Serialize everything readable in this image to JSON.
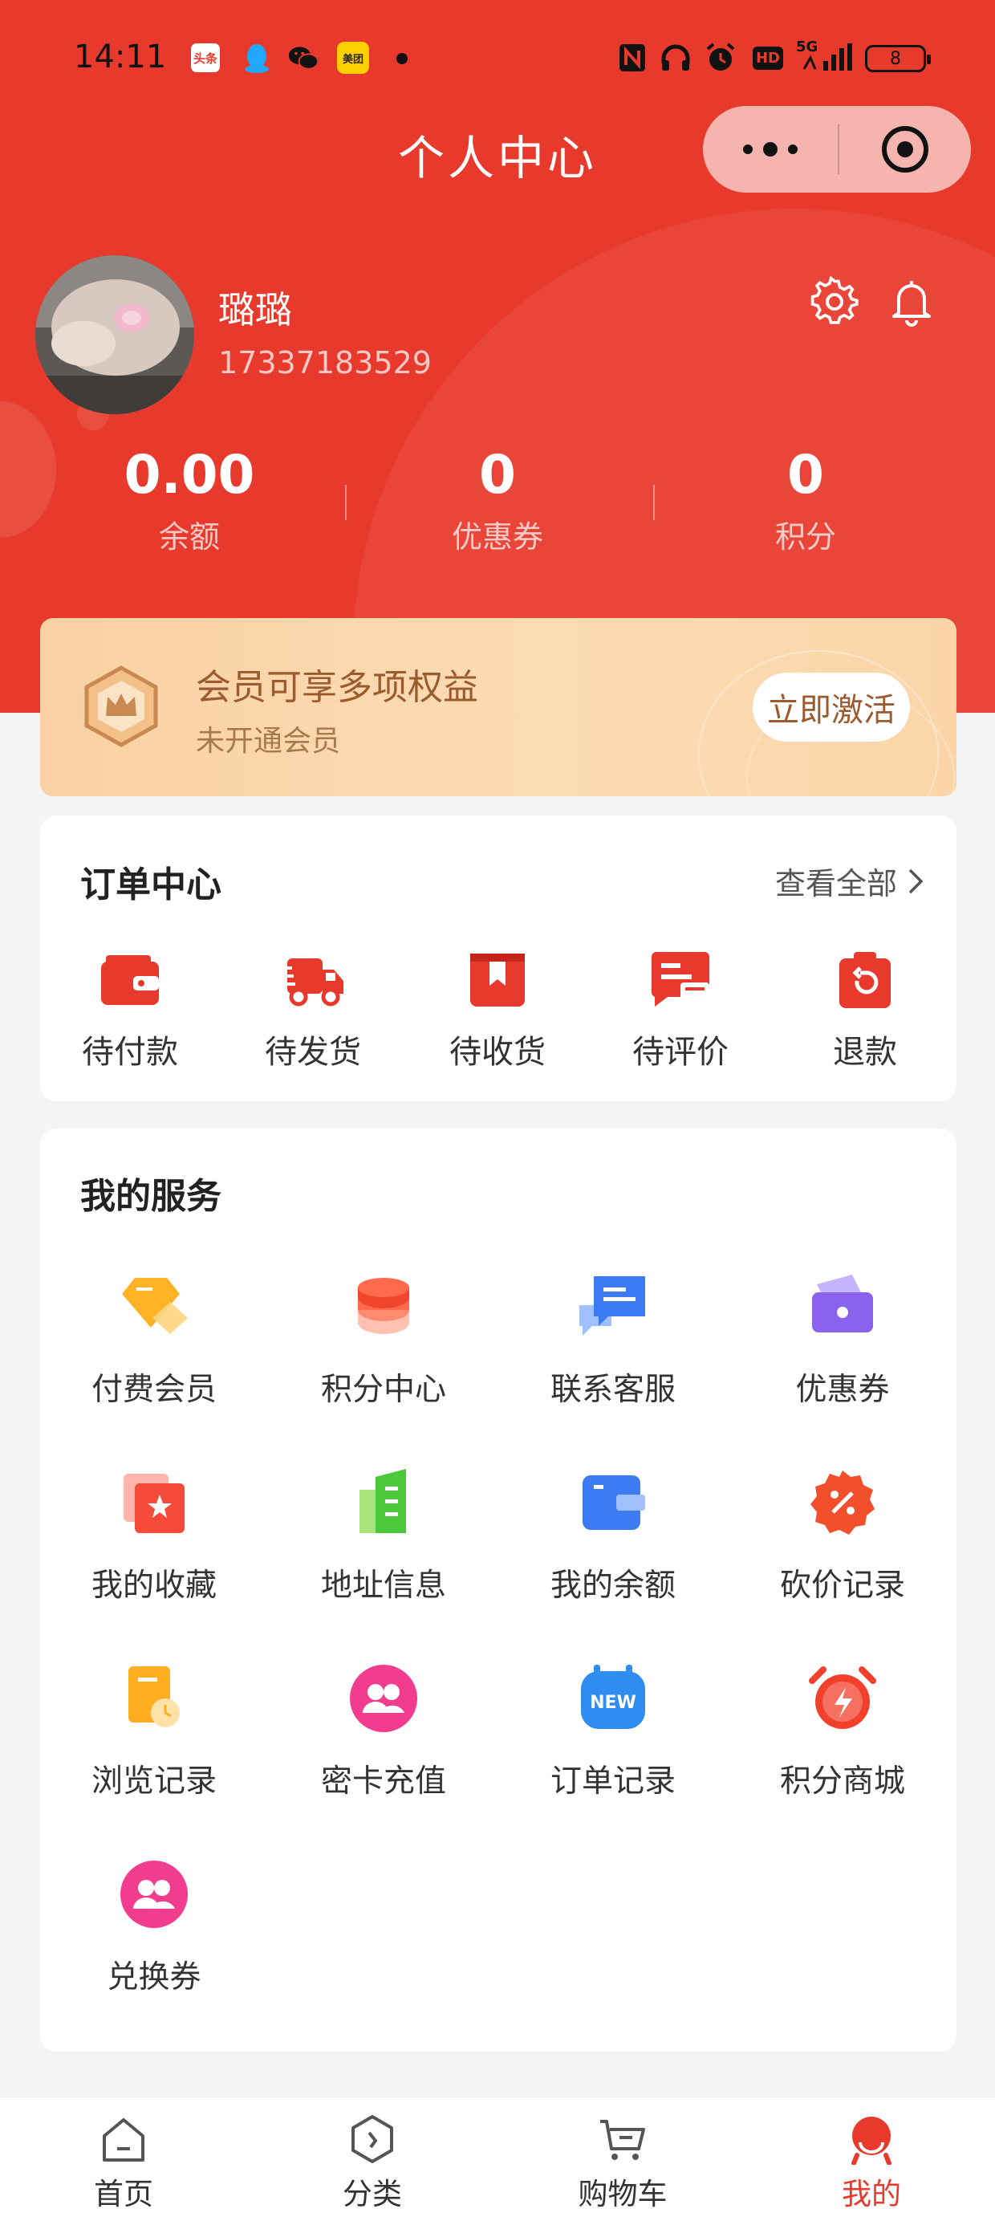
{
  "status_bar": {
    "time": "14:11",
    "battery": "8",
    "app_toutiao": "头条",
    "app_meituan": "美团",
    "network": "5G",
    "hd": "HD"
  },
  "nav": {
    "title": "个人中心"
  },
  "profile": {
    "name": "璐璐",
    "phone": "17337183529"
  },
  "stats": [
    {
      "value": "0.00",
      "label": "余额"
    },
    {
      "value": "0",
      "label": "优惠券"
    },
    {
      "value": "0",
      "label": "积分"
    }
  ],
  "vip": {
    "title": "会员可享多项权益",
    "subtitle": "未开通会员",
    "button": "立即激活"
  },
  "orders": {
    "title": "订单中心",
    "see_all": "查看全部",
    "items": [
      {
        "label": "待付款",
        "icon": "wallet-icon"
      },
      {
        "label": "待发货",
        "icon": "truck-icon"
      },
      {
        "label": "待收货",
        "icon": "box-icon"
      },
      {
        "label": "待评价",
        "icon": "comment-icon"
      },
      {
        "label": "退款",
        "icon": "refund-icon"
      }
    ]
  },
  "services": {
    "title": "我的服务",
    "items": [
      {
        "label": "付费会员",
        "icon": "diamond-icon"
      },
      {
        "label": "积分中心",
        "icon": "coins-icon"
      },
      {
        "label": "联系客服",
        "icon": "chat-icon"
      },
      {
        "label": "优惠券",
        "icon": "ticket-icon"
      },
      {
        "label": "我的收藏",
        "icon": "star-icon"
      },
      {
        "label": "地址信息",
        "icon": "building-icon"
      },
      {
        "label": "我的余额",
        "icon": "wallet-blue-icon"
      },
      {
        "label": "砍价记录",
        "icon": "discount-icon"
      },
      {
        "label": "浏览记录",
        "icon": "history-icon"
      },
      {
        "label": "密卡充值",
        "icon": "users-pink-icon"
      },
      {
        "label": "订单记录",
        "icon": "new-badge-icon"
      },
      {
        "label": "积分商城",
        "icon": "alarm-icon"
      },
      {
        "label": "兑换券",
        "icon": "users-pink-icon"
      }
    ]
  },
  "tabbar": {
    "items": [
      {
        "label": "首页",
        "icon": "home-icon"
      },
      {
        "label": "分类",
        "icon": "category-icon"
      },
      {
        "label": "购物车",
        "icon": "cart-icon"
      },
      {
        "label": "我的",
        "icon": "profile-icon"
      }
    ],
    "active_color": "#e83a2c"
  },
  "colors": {
    "brand": "#e83a2c",
    "vip_text": "#9b5b2e"
  }
}
